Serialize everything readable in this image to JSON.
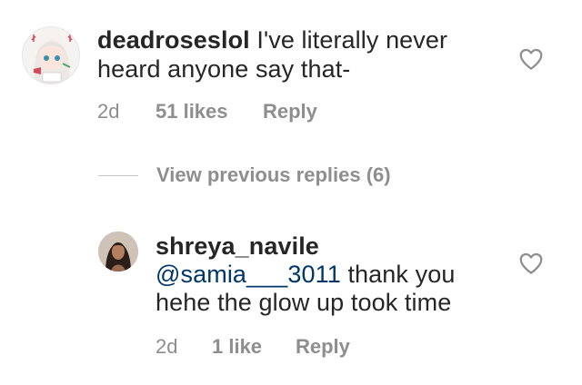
{
  "comment": {
    "username": "deadroseslol",
    "text_line1": "I've literally never",
    "text_line2": "heard anyone say that-",
    "time": "2d",
    "likes": "51 likes",
    "reply_label": "Reply"
  },
  "thread": {
    "view_previous": "View previous replies (6)"
  },
  "reply": {
    "username": "shreya_navile",
    "mention": "@samia___3011",
    "text_line1_rest": " thank you",
    "text_line2": "hehe the glow up took time",
    "time": "2d",
    "likes": "1 like",
    "reply_label": "Reply"
  }
}
